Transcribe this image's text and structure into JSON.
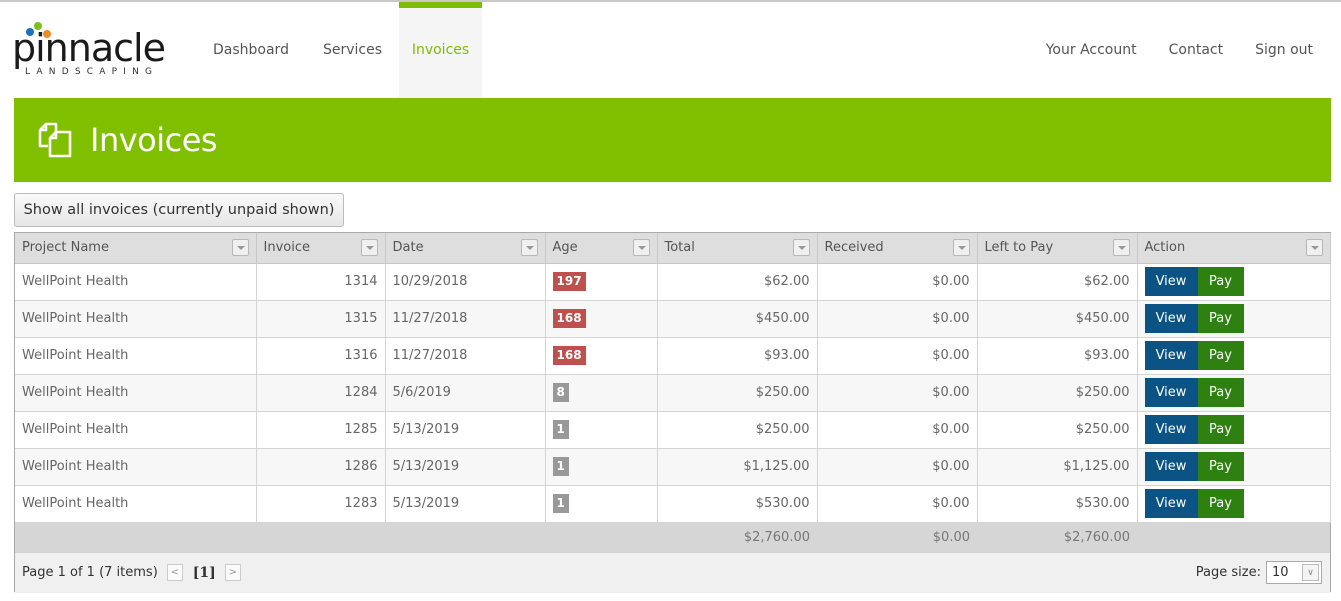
{
  "brand": {
    "name": "pinnacle",
    "tagline": "LANDSCAPING"
  },
  "nav": {
    "left": [
      {
        "label": "Dashboard",
        "active": false
      },
      {
        "label": "Services",
        "active": false
      },
      {
        "label": "Invoices",
        "active": true
      }
    ],
    "right": [
      {
        "label": "Your Account"
      },
      {
        "label": "Contact"
      },
      {
        "label": "Sign out"
      }
    ]
  },
  "page": {
    "title": "Invoices",
    "icon": "documents-icon"
  },
  "toggle_button": "Show all invoices (currently unpaid shown)",
  "grid": {
    "columns": [
      "Project Name",
      "Invoice",
      "Date",
      "Age",
      "Total",
      "Received",
      "Left to Pay",
      "Action"
    ],
    "rows": [
      {
        "project": "WellPoint Health",
        "invoice": "1314",
        "date": "10/29/2018",
        "age": "197",
        "overdue": true,
        "total": "$62.00",
        "received": "$0.00",
        "left": "$62.00"
      },
      {
        "project": "WellPoint Health",
        "invoice": "1315",
        "date": "11/27/2018",
        "age": "168",
        "overdue": true,
        "total": "$450.00",
        "received": "$0.00",
        "left": "$450.00"
      },
      {
        "project": "WellPoint Health",
        "invoice": "1316",
        "date": "11/27/2018",
        "age": "168",
        "overdue": true,
        "total": "$93.00",
        "received": "$0.00",
        "left": "$93.00"
      },
      {
        "project": "WellPoint Health",
        "invoice": "1284",
        "date": "5/6/2019",
        "age": "8",
        "overdue": false,
        "total": "$250.00",
        "received": "$0.00",
        "left": "$250.00"
      },
      {
        "project": "WellPoint Health",
        "invoice": "1285",
        "date": "5/13/2019",
        "age": "1",
        "overdue": false,
        "total": "$250.00",
        "received": "$0.00",
        "left": "$250.00"
      },
      {
        "project": "WellPoint Health",
        "invoice": "1286",
        "date": "5/13/2019",
        "age": "1",
        "overdue": false,
        "total": "$1,125.00",
        "received": "$0.00",
        "left": "$1,125.00"
      },
      {
        "project": "WellPoint Health",
        "invoice": "1283",
        "date": "5/13/2019",
        "age": "1",
        "overdue": false,
        "total": "$530.00",
        "received": "$0.00",
        "left": "$530.00"
      }
    ],
    "actions": {
      "view": "View",
      "pay": "Pay"
    },
    "totals": {
      "total": "$2,760.00",
      "received": "$0.00",
      "left": "$2,760.00"
    }
  },
  "pager": {
    "summary": "Page 1 of 1 (7 items)",
    "prev": "<",
    "current": "[1]",
    "next": ">",
    "page_size_label": "Page size:",
    "page_size": "10"
  },
  "colors": {
    "brand_green": "#80be00",
    "overdue_red": "#c0504d",
    "view_blue": "#0b5285",
    "pay_green": "#2e8010"
  }
}
